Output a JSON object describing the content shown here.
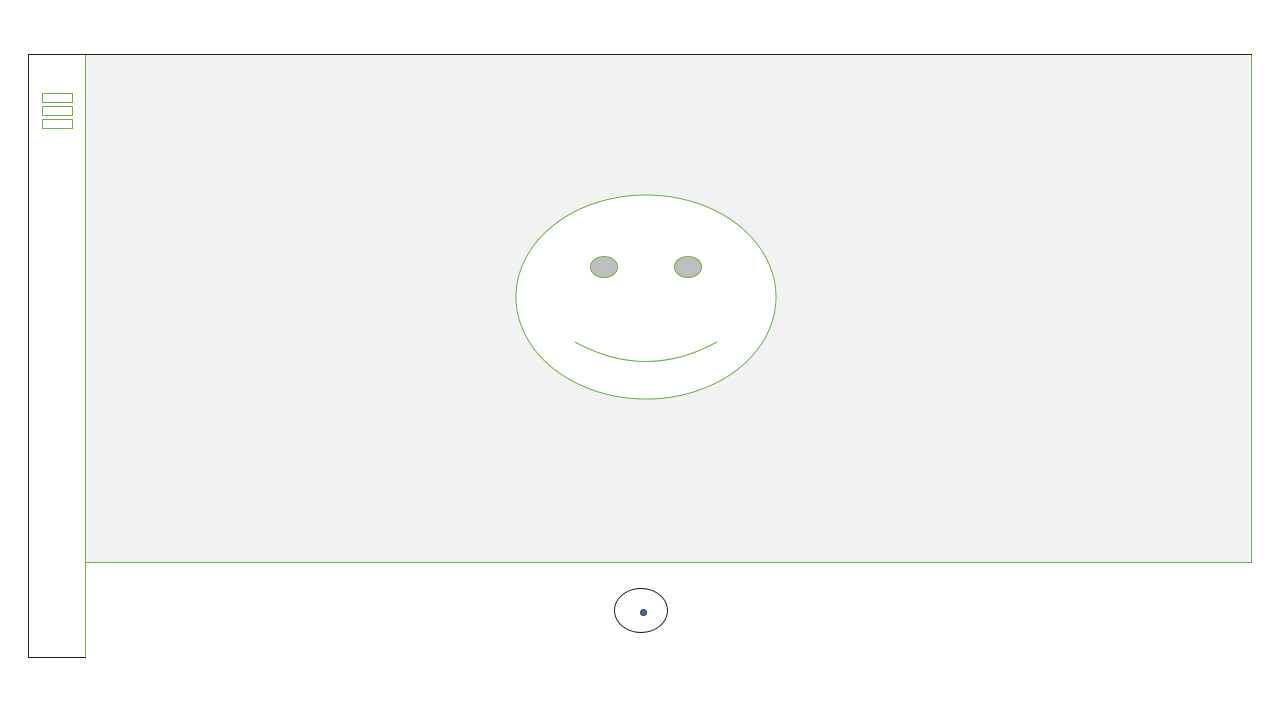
{
  "device": {
    "accent_color": "#70ad47",
    "frame_color": "#222222",
    "stage_color": "#f2f2f2"
  },
  "sidebar": {
    "menu_icon": "hamburger-menu-icon"
  },
  "stage": {
    "image": "smiley-face",
    "face_fill": "#ffffff",
    "eye_fill": "#bfbfbf"
  },
  "bottom_bar": {
    "button_icon": "home-button-icon",
    "dot_color": "#3a6ea5"
  }
}
